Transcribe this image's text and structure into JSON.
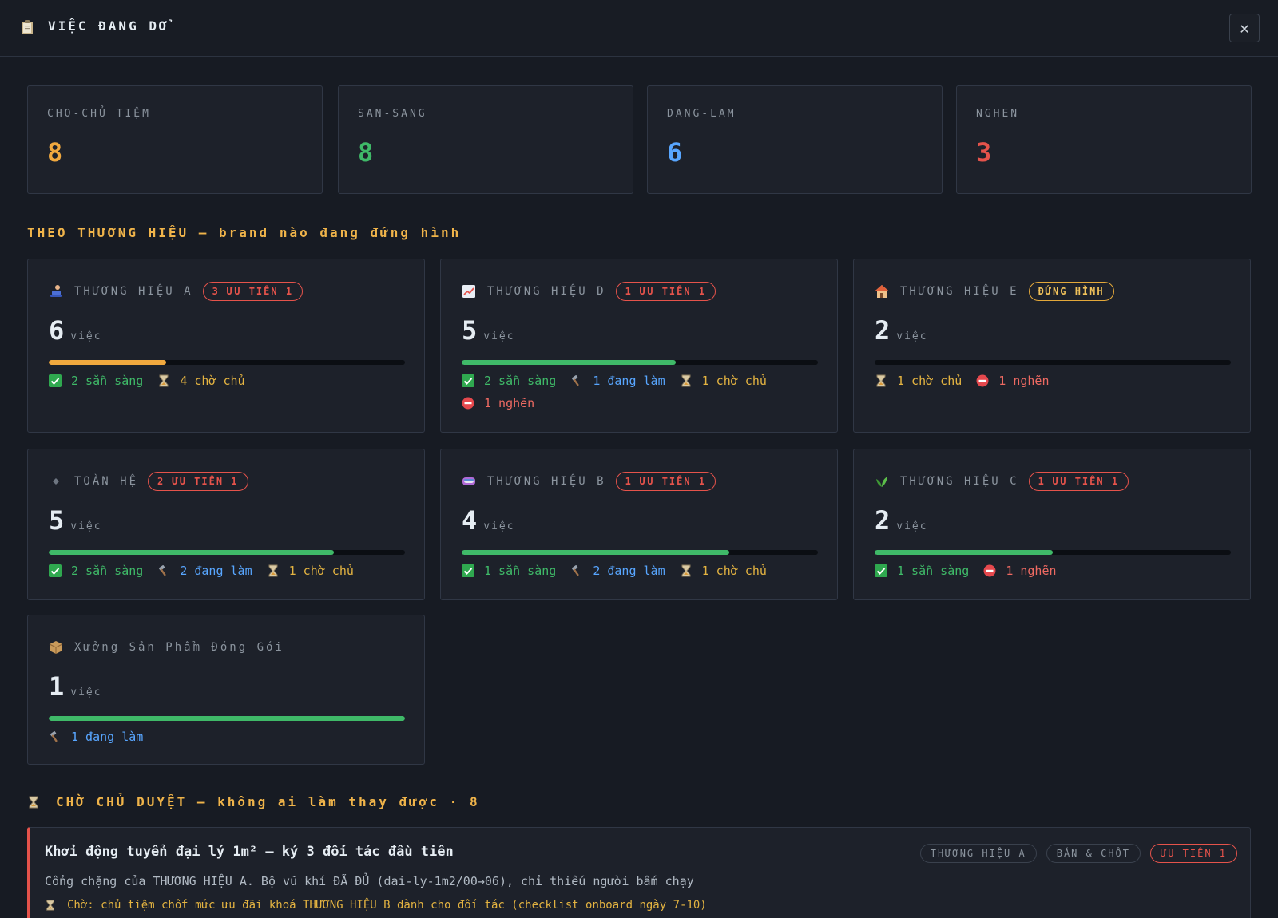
{
  "header": {
    "title": "VIỆC ĐANG DỞ",
    "icon": "clipboard-icon",
    "close_icon": "close-icon"
  },
  "stats": [
    {
      "label": "CHO-CHỦ TIỆM",
      "value": "8",
      "color": "#f0a83e"
    },
    {
      "label": "SAN-SANG",
      "value": "8",
      "color": "#3fb968"
    },
    {
      "label": "DANG-LAM",
      "value": "6",
      "color": "#58a6ff"
    },
    {
      "label": "NGHEN",
      "value": "3",
      "color": "#e5534b"
    }
  ],
  "brands_section": {
    "title": "THEO THƯƠNG HIỆU — brand nào đang đứng hình"
  },
  "brands": [
    {
      "name": "THƯƠNG HIỆU A",
      "icon": "person-icon",
      "badge": "3 ƯU TIÊN 1",
      "badge_style": "red",
      "count": "6",
      "unit": "việc",
      "progress": 0.33,
      "bar_color": "#f0a83e",
      "chips": [
        {
          "icon": "check-icon",
          "text": "2 sẵn sàng",
          "tone": "green"
        },
        {
          "icon": "hourglass-icon",
          "text": "4 chờ chủ",
          "tone": "yellow"
        }
      ]
    },
    {
      "name": "THƯƠNG HIỆU D",
      "icon": "chart-icon",
      "badge": "1 ƯU TIÊN 1",
      "badge_style": "red",
      "count": "5",
      "unit": "việc",
      "progress": 0.6,
      "bar_color": "#3fb968",
      "chips": [
        {
          "icon": "check-icon",
          "text": "2 sẵn sàng",
          "tone": "green"
        },
        {
          "icon": "hammer-icon",
          "text": "1 đang làm",
          "tone": "blue"
        },
        {
          "icon": "hourglass-icon",
          "text": "1 chờ chủ",
          "tone": "yellow"
        },
        {
          "icon": "blocked-icon",
          "text": "1 nghẽn",
          "tone": "red"
        }
      ]
    },
    {
      "name": "THƯƠNG HIỆU E",
      "icon": "house-icon",
      "badge": "ĐỨNG HÌNH",
      "badge_style": "yellow",
      "count": "2",
      "unit": "việc",
      "progress": 0,
      "bar_color": "#3fb968",
      "chips": [
        {
          "icon": "hourglass-icon",
          "text": "1 chờ chủ",
          "tone": "yellow"
        },
        {
          "icon": "blocked-icon",
          "text": "1 nghẽn",
          "tone": "red"
        }
      ]
    },
    {
      "name": "TOÀN HỆ",
      "icon": "diamond-icon",
      "badge": "2 ƯU TIÊN 1",
      "badge_style": "red",
      "count": "5",
      "unit": "việc",
      "progress": 0.8,
      "bar_color": "#3fb968",
      "chips": [
        {
          "icon": "check-icon",
          "text": "2 sẵn sàng",
          "tone": "green"
        },
        {
          "icon": "hammer-icon",
          "text": "2 đang làm",
          "tone": "blue"
        },
        {
          "icon": "hourglass-icon",
          "text": "1 chờ chủ",
          "tone": "yellow"
        }
      ]
    },
    {
      "name": "THƯƠNG HIỆU B",
      "icon": "goggles-icon",
      "badge": "1 ƯU TIÊN 1",
      "badge_style": "red",
      "count": "4",
      "unit": "việc",
      "progress": 0.75,
      "bar_color": "#3fb968",
      "chips": [
        {
          "icon": "check-icon",
          "text": "1 sẵn sàng",
          "tone": "green"
        },
        {
          "icon": "hammer-icon",
          "text": "2 đang làm",
          "tone": "blue"
        },
        {
          "icon": "hourglass-icon",
          "text": "1 chờ chủ",
          "tone": "yellow"
        }
      ]
    },
    {
      "name": "THƯƠNG HIỆU C",
      "icon": "leaf-icon",
      "badge": "1 ƯU TIÊN 1",
      "badge_style": "red",
      "count": "2",
      "unit": "việc",
      "progress": 0.5,
      "bar_color": "#3fb968",
      "chips": [
        {
          "icon": "check-icon",
          "text": "1 sẵn sàng",
          "tone": "green"
        },
        {
          "icon": "blocked-icon",
          "text": "1 nghẽn",
          "tone": "red"
        }
      ]
    },
    {
      "name": "Xưởng Sản Phẩm Đóng Gói",
      "icon": "package-icon",
      "badge": "",
      "badge_style": "",
      "count": "1",
      "unit": "việc",
      "progress": 1,
      "bar_color": "#3fb968",
      "chips": [
        {
          "icon": "hammer-icon",
          "text": "1 đang làm",
          "tone": "blue"
        }
      ]
    }
  ],
  "waiting_section": {
    "title": "CHỜ CHỦ DUYỆT — không ai làm thay được · 8",
    "icon": "hourglass-icon"
  },
  "waiting_items": [
    {
      "title": "Khởi động tuyển đại lý 1m² — ký 3 đối tác đầu tiên",
      "tags": [
        {
          "text": "THƯƠNG HIỆU A",
          "style": "gray"
        },
        {
          "text": "BÁN & CHỐT",
          "style": "gray"
        },
        {
          "text": "ƯU TIÊN 1",
          "style": "red"
        }
      ],
      "description": "Cổng chặng của THƯƠNG HIỆU A. Bộ vũ khí ĐÃ ĐỦ (dai-ly-1m2/00→06), chỉ thiếu người bấm chạy",
      "note": "Chờ: chủ tiệm chốt mức ưu đãi khoá THƯƠNG HIỆU B dành cho đối tác (checklist onboard ngày 7-10)"
    }
  ]
}
